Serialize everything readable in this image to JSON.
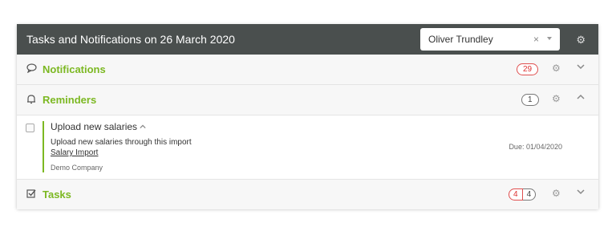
{
  "header": {
    "title": "Tasks and Notifications on 26 March 2020",
    "user_select": {
      "value": "Oliver Trundley",
      "clear": "×"
    },
    "gear_icon": "gear-icon"
  },
  "sections": {
    "notifications": {
      "icon": "speech-bubble-icon",
      "title": "Notifications",
      "badge": "29",
      "expanded": false
    },
    "reminders": {
      "icon": "bell-icon",
      "title": "Reminders",
      "badge": "1",
      "expanded": true
    },
    "tasks": {
      "icon": "checked-box-icon",
      "title": "Tasks",
      "badge_left": "4",
      "badge_right": "4",
      "expanded": false
    }
  },
  "reminder_item": {
    "title": "Upload new salaries",
    "description": "Upload new salaries through this import",
    "link": "Salary Import",
    "company": "Demo Company",
    "due": "Due: 01/04/2020"
  },
  "colors": {
    "header_bg": "#4a4f4e",
    "accent": "#7cb822",
    "badge_red": "#e05050"
  }
}
